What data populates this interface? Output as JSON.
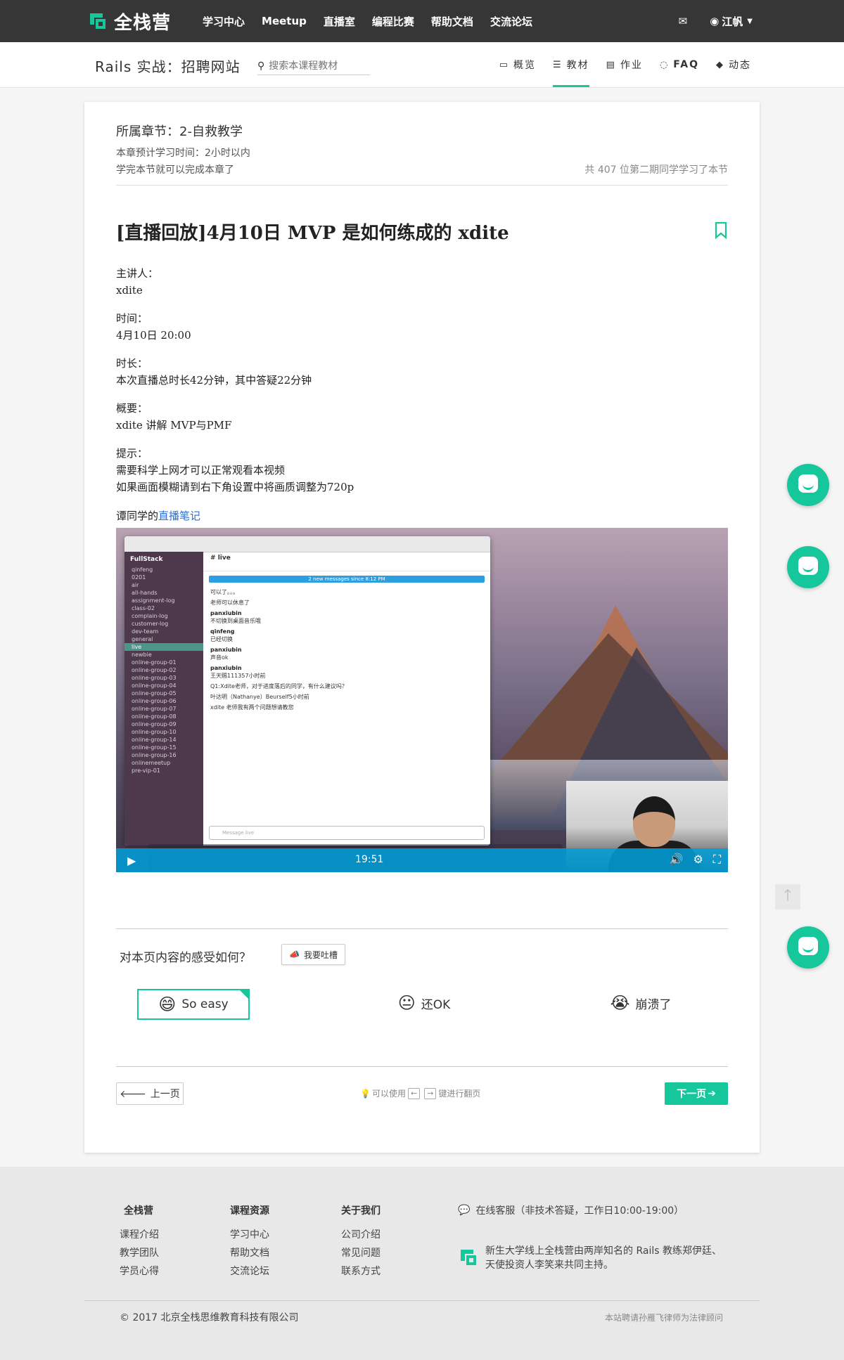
{
  "topnav": {
    "logo_text": "全栈营",
    "links": [
      "学习中心",
      "Meetup",
      "直播室",
      "编程比赛",
      "帮助文档",
      "交流论坛"
    ],
    "user_name": "江帆",
    "brand_color": "#16c79b"
  },
  "course": {
    "title": "Rails 实战：招聘网站",
    "search_placeholder": "搜索本课程教材",
    "tabs": [
      {
        "icon": "monitor-icon",
        "label": "概览"
      },
      {
        "icon": "list-icon",
        "label": "教材",
        "active": true
      },
      {
        "icon": "file-icon",
        "label": "作业"
      },
      {
        "icon": "chat-icon",
        "label": "FAQ"
      },
      {
        "icon": "tag-icon",
        "label": "动态"
      }
    ]
  },
  "chapter": {
    "title": "所属章节：2-自救教学",
    "study_time": "本章预计学习时间：2小时以内",
    "finish_note": "学完本节就可以完成本章了",
    "learner_count": "共 407 位第二期同学学习了本节"
  },
  "lesson": {
    "title": "[直播回放]4月10日 MVP 是如何练成的 xdite",
    "blocks": [
      [
        "主讲人：",
        "xdite"
      ],
      [
        "时间：",
        "4月10日 20:00"
      ],
      [
        "时长：",
        "本次直播总时长42分钟，其中答疑22分钟"
      ],
      [
        "概要：",
        "xdite 讲解 MVP与PMF"
      ],
      [
        "提示：",
        "需要科学上网才可以正常观看本视频",
        "如果画面模糊请到右下角设置中将画质调整为720p"
      ]
    ],
    "notes_prefix": "谭同学的",
    "notes_link": "直播笔记"
  },
  "video": {
    "time": "19:51",
    "slack": {
      "team": "FullStack",
      "channels": [
        "qinfeng",
        "0201",
        "air",
        "all-hands",
        "assignment-log",
        "class-02",
        "complain-log",
        "customer-log",
        "dev-team",
        "general",
        "live",
        "newbie",
        "online-group-01",
        "online-group-02",
        "online-group-03",
        "online-group-04",
        "online-group-05",
        "online-group-06",
        "online-group-07",
        "online-group-08",
        "online-group-09",
        "online-group-10",
        "online-group-14",
        "online-group-15",
        "online-group-16",
        "onlinemeetup",
        "pre-vip-01"
      ],
      "active_channel": "live",
      "channel_title": "live",
      "banner": "2 new messages since 8:12 PM",
      "messages": [
        {
          "user": "",
          "text": "可以了。。。"
        },
        {
          "user": "",
          "text": "老师可以休息了"
        },
        {
          "user": "panxiubin",
          "text": "不切换到桌面音乐哦"
        },
        {
          "user": "qinfeng",
          "text": "已经切换"
        },
        {
          "user": "panxiubin",
          "text": "声音ok"
        },
        {
          "user": "panxiubin",
          "text": "王天赐111357小时前"
        },
        {
          "user": "",
          "text": "Q1:Xdite老师，对于进度落后的同学，有什么建议吗？"
        },
        {
          "user": "",
          "text": "叶达明（Nathanye）Beurself5小时前"
        },
        {
          "user": "",
          "text": "xdite 老师我有两个问题想请教您"
        }
      ],
      "input_placeholder": "Message live"
    }
  },
  "feedback": {
    "question": "对本页内容的感受如何？",
    "complain_label": "我要吐槽",
    "options": [
      {
        "emoji": "😄",
        "label": "So easy",
        "selected": true
      },
      {
        "emoji": "😐",
        "label": "还OK"
      },
      {
        "emoji": "😭",
        "label": "崩溃了"
      }
    ]
  },
  "pager": {
    "prev": "上一页",
    "hint_prefix": "可以使用",
    "key_left": "←",
    "key_right": "→",
    "hint_suffix": "键进行翻页",
    "next": "下一页"
  },
  "footer": {
    "cols": [
      {
        "title": "全栈营",
        "items": [
          "课程介绍",
          "教学团队",
          "学员心得"
        ]
      },
      {
        "title": "课程资源",
        "items": [
          "学习中心",
          "帮助文档",
          "交流论坛"
        ]
      },
      {
        "title": "关于我们",
        "items": [
          "公司介绍",
          "常见问题",
          "联系方式"
        ]
      }
    ],
    "service": "在线客服（非技术答疑，工作日10:00-19:00）",
    "intro": "新生大学线上全栈营由两岸知名的 Rails 教练郑伊廷、天使投资人李笑来共同主持。",
    "copyright": "© 2017 北京全栈思维教育科技有限公司",
    "lawyer": "本站聘请孙雁飞律师为法律顾问"
  }
}
